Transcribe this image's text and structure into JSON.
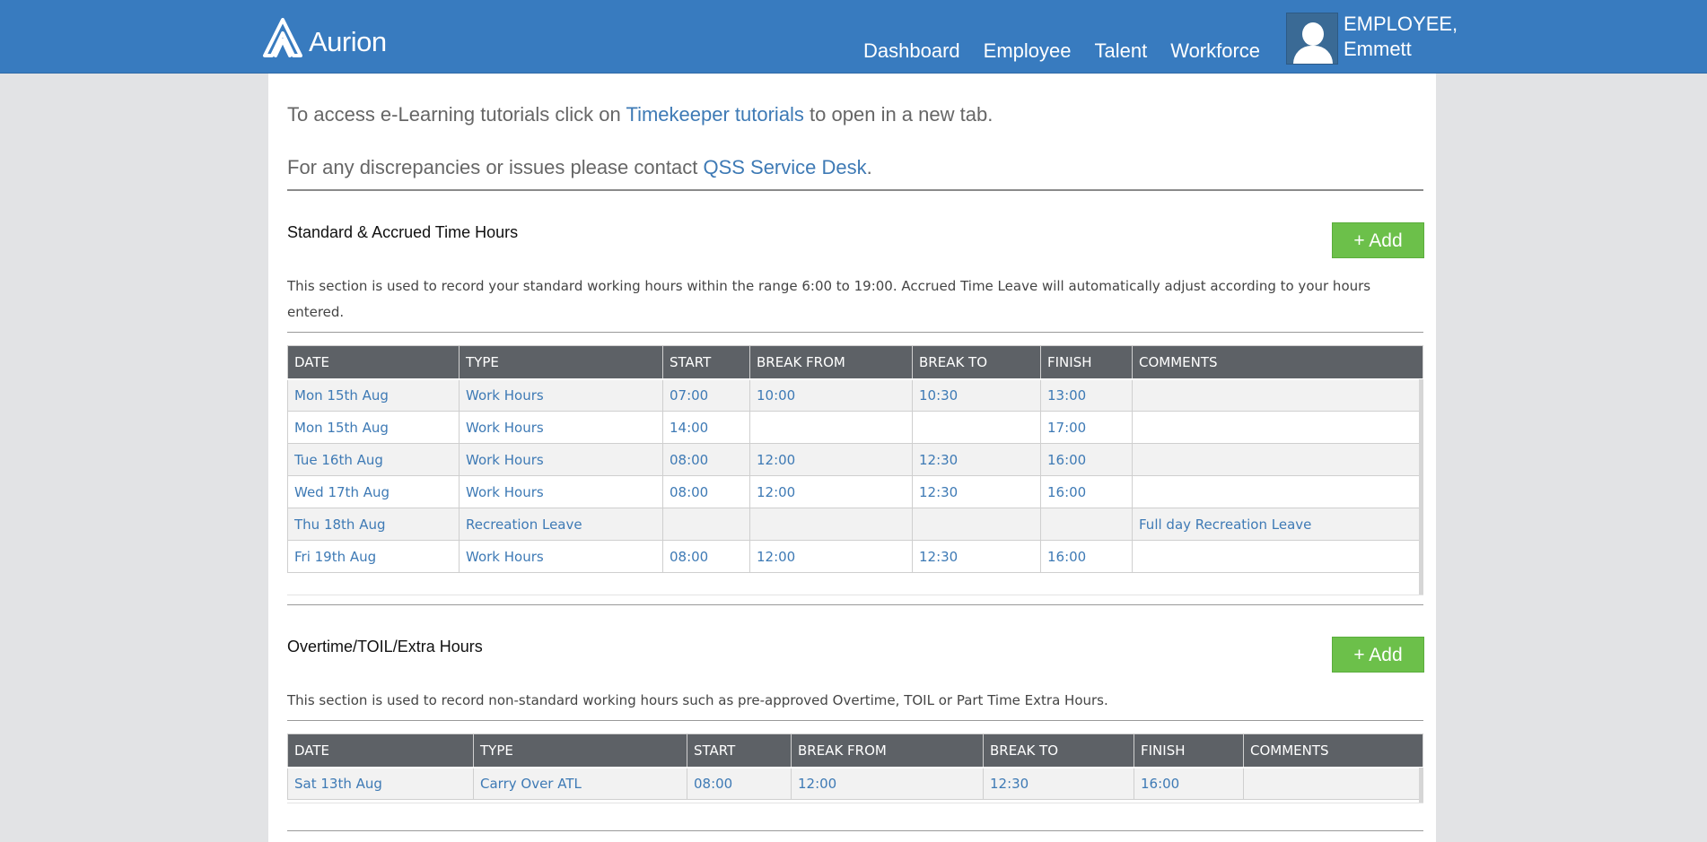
{
  "header": {
    "logo_text": "Aurion",
    "nav": [
      "Dashboard",
      "Employee",
      "Talent",
      "Workforce"
    ],
    "user_line1": "EMPLOYEE,",
    "user_line2": "Emmett"
  },
  "intro": {
    "tutorials_prefix": "To access e-Learning tutorials click on ",
    "tutorials_link": "Timekeeper tutorials",
    "tutorials_suffix": " to open in a new tab.",
    "contact_prefix": "For any discrepancies or issues please contact ",
    "contact_link": "QSS Service Desk",
    "contact_suffix": "."
  },
  "standard": {
    "title": "Standard & Accrued Time Hours",
    "add_label": "+ Add",
    "description": "This section is used to record your standard working hours within the range 6:00 to 19:00. Accrued Time Leave will automatically adjust according to your hours entered.",
    "columns": [
      "DATE",
      "TYPE",
      "START",
      "BREAK FROM",
      "BREAK TO",
      "FINISH",
      "COMMENTS"
    ],
    "rows": [
      [
        "Mon 15th Aug",
        "Work Hours",
        "07:00",
        "10:00",
        "10:30",
        "13:00",
        ""
      ],
      [
        "Mon 15th Aug",
        "Work Hours",
        "14:00",
        "",
        "",
        "17:00",
        ""
      ],
      [
        "Tue 16th Aug",
        "Work Hours",
        "08:00",
        "12:00",
        "12:30",
        "16:00",
        ""
      ],
      [
        "Wed 17th Aug",
        "Work Hours",
        "08:00",
        "12:00",
        "12:30",
        "16:00",
        ""
      ],
      [
        "Thu 18th Aug",
        "Recreation Leave",
        "",
        "",
        "",
        "",
        "Full day Recreation Leave"
      ],
      [
        "Fri 19th Aug",
        "Work Hours",
        "08:00",
        "12:00",
        "12:30",
        "16:00",
        ""
      ]
    ]
  },
  "overtime": {
    "title": "Overtime/TOIL/Extra Hours",
    "add_label": "+ Add",
    "description": "This section is used to record non-standard working hours such as pre-approved Overtime, TOIL or Part Time Extra Hours.",
    "columns": [
      "DATE",
      "TYPE",
      "START",
      "BREAK FROM",
      "BREAK TO",
      "FINISH",
      "COMMENTS"
    ],
    "rows": [
      [
        "Sat 13th Aug",
        "Carry Over ATL",
        "08:00",
        "12:00",
        "12:30",
        "16:00",
        ""
      ]
    ]
  },
  "colors": {
    "header_bg": "#387bbf",
    "link": "#3e7ab5",
    "add_button": "#6cc04a",
    "table_header_bg": "#5d6166"
  }
}
